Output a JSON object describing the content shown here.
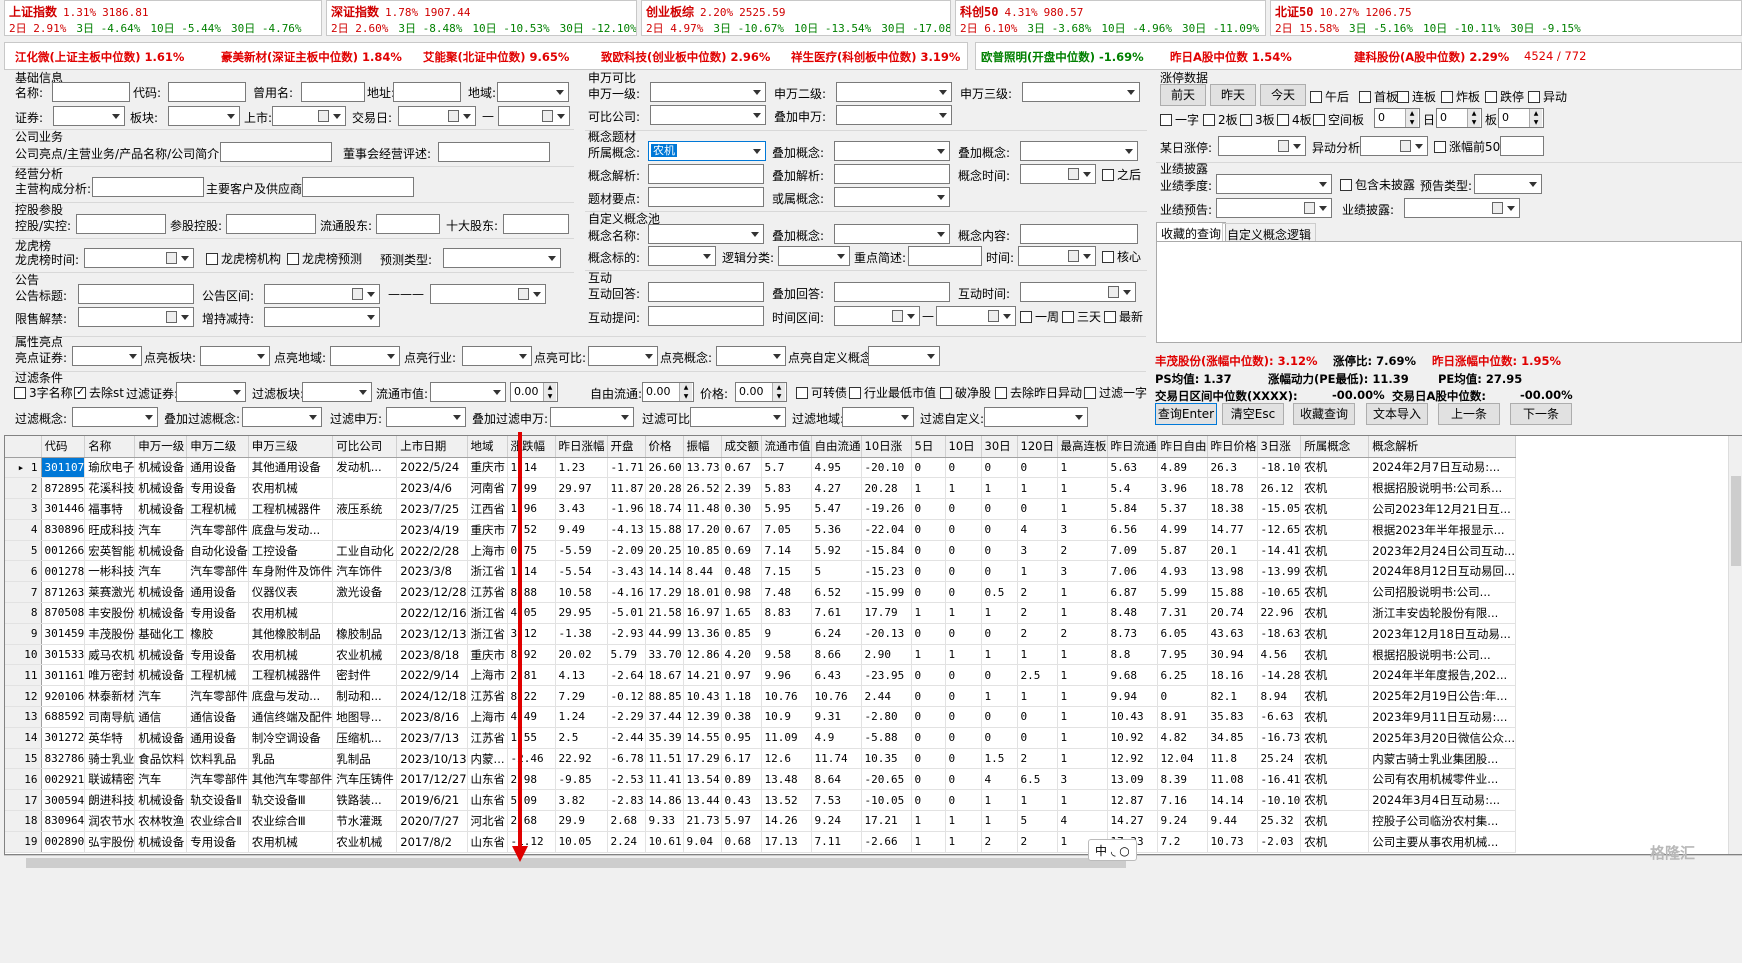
{
  "indices": [
    {
      "name": "上证指数",
      "pct": "1.31%",
      "value": "3186.81",
      "d2": "2日 2.91%",
      "d3": "3日 -4.64%",
      "d10": "10日 -5.44%",
      "d30": "30日 -4.76%"
    },
    {
      "name": "深证指数",
      "pct": "1.78%",
      "value": "1907.44",
      "d2": "2日 2.60%",
      "d3": "3日 -8.48%",
      "d10": "10日 -10.53%",
      "d30": "30日 -12.10%"
    },
    {
      "name": "创业板综",
      "pct": "2.20%",
      "value": "2525.59",
      "d2": "2日 4.97%",
      "d3": "3日 -10.67%",
      "d10": "10日 -13.54%",
      "d30": "30日 -17.08%"
    },
    {
      "name": "科创50",
      "pct": "4.31%",
      "value": "980.57",
      "d2": "2日 6.10%",
      "d3": "3日 -3.68%",
      "d10": "10日 -4.96%",
      "d30": "30日 -11.09%"
    },
    {
      "name": "北证50",
      "pct": "10.27%",
      "value": "1206.75",
      "d2": "2日 15.58%",
      "d3": "3日 -5.16%",
      "d10": "10日 -10.11%",
      "d30": "30日 -9.15%"
    }
  ],
  "marquee1": [
    "江化微(上证主板中位数) 1.61%",
    "豪美新材(深证主板中位数) 1.84%",
    "艾能聚(北证中位数) 9.65%",
    "致欧科技(创业板中位数) 2.96%",
    "祥生医疗(科创板中位数) 3.19%"
  ],
  "marquee2": [
    "欧普照明(开盘中位数) -1.69%",
    "昨日A股中位数 1.54%",
    "建科股份(A股中位数) 2.29%",
    "4524 / 772"
  ],
  "labels": {
    "basic": "基础信息",
    "name": "名称:",
    "code": "代码:",
    "oldname": "曾用名:",
    "addr": "地址:",
    "region": "地域:",
    "sec": "证券:",
    "board": "板块:",
    "list": "上市:",
    "tday": "交易日:",
    "dash": "—",
    "biz": "公司业务",
    "bizhl": "公司亮点/主营业务/产品名称/公司简介:",
    "boardrev": "董事会经营评述:",
    "ops": "经营分析",
    "mainbiz": "主营构成分析:",
    "cust": "主要客户及供应商:",
    "hold": "控股参股",
    "holdctrl": "控股/实控:",
    "part": "参股控股:",
    "float": "流通股东:",
    "top10": "十大股东:",
    "lhb": "龙虎榜",
    "lhbtime": "龙虎榜时间:",
    "lhbinst": "龙虎榜机构",
    "lhbpred": "龙虎榜预测",
    "predtype": "预测类型:",
    "ann": "公告",
    "anntitle": "公告标题:",
    "annrange": "公告区间:",
    "annline": "———",
    "unlock": "限售解禁:",
    "incdec": "增持减持:",
    "sw": "申万可比",
    "sw1": "申万一级:",
    "sw2": "申万二级:",
    "sw3": "申万三级:",
    "comp": "可比公司:",
    "addsw": "叠加申万:",
    "concept": "概念题材",
    "ownconcept": "所属概念:",
    "ownconceptval": "农机",
    "addconcept": "叠加概念:",
    "addconcept2": "叠加概念:",
    "cparse": "概念解析:",
    "addparse": "叠加解析:",
    "ctime": "概念时间:",
    "after": "之后",
    "keypoint": "题材要点:",
    "orconcept": "或属概念:",
    "custom": "自定义概念池",
    "cname": "概念名称:",
    "addc": "叠加概念:",
    "ccontent": "概念内容:",
    "ctarget": "概念标的:",
    "logic": "逻辑分类:",
    "keydesc": "重点简述:",
    "time": "时间:",
    "core": "核心",
    "interact": "互动",
    "iq": "互动回答:",
    "addq": "叠加回答:",
    "itime": "互动时间:",
    "ia": "互动提问:",
    "trange": "时间区间:",
    "tdash": "—",
    "week": "一周",
    "three": "三天",
    "latest": "最新",
    "highlight": "属性亮点",
    "hlsec": "亮点证券:",
    "hlboard": "点亮板块:",
    "hlregion": "点亮地域:",
    "hlind": "点亮行业:",
    "hlcomp": "点亮可比:",
    "hlconcept": "点亮概念:",
    "hlcustom": "点亮自定义概念:",
    "filter": "过滤条件",
    "f3": "3字名称",
    "fst": "去除st",
    "fsec": "过滤证券:",
    "fboard": "过滤板块:",
    "fmv": "流通市值:",
    "fmvval": "0.00",
    "ffree": "自由流通:",
    "ffreeval": "0.00",
    "fprice": "价格:",
    "fpriceval": "0.00",
    "fcb": "可转债",
    "flow": "行业最低市值",
    "fbreak": "破净股",
    "fabn": "去除昨日异动",
    "fone": "过滤一字",
    "fconcept": "过滤概念:",
    "faddconcept": "叠加过滤概念:",
    "fsw": "过滤申万:",
    "faddsw": "叠加过滤申万:",
    "fcomp": "过滤可比:",
    "fregion": "过滤地域:",
    "fcustom": "过滤自定义:",
    "limit": "涨停数据",
    "prev": "前天",
    "yest": "昨天",
    "today": "今天",
    "noon": "午后",
    "first": "首板",
    "cont": "连板",
    "blow": "炸板",
    "down": "跌停",
    "abn": "异动",
    "one": "一字",
    "b2": "2板",
    "b3": "3板",
    "b4": "4板",
    "empty": "空间板",
    "sp1": "0",
    "day": "日",
    "sp2": "0",
    "ban": "板",
    "sp3": "0",
    "someday": "某日涨停:",
    "abnanal": "异动分析:",
    "top50": "涨幅前50",
    "perf": "业绩披露",
    "perfq": "业绩季度:",
    "incl": "包含未披露",
    "pretype": "预告类型:",
    "perfpre": "业绩预告:",
    "perfdisc": "业绩披露:",
    "tabfav": "收藏的查询",
    "tabcustom": "自定义概念逻辑",
    "stat1": "丰茂股份(涨幅中位数): 3.12%",
    "stat2": "涨停比: 7.69%",
    "stat3": "昨日涨幅中位数: 1.95%",
    "pe": "PS均值: 1.37",
    "power": "涨幅动力(PE最低): 11.39",
    "pemean": "PE均值: 27.95",
    "mid1": "交易日区间中位数(XXXX):",
    "mid1v": "-00.00%",
    "mid2": "交易日A股中位数:",
    "mid2v": "-00.00%",
    "bquery": "查询Enter",
    "bclear": "清空Esc",
    "bfav": "收藏查询",
    "bimport": "文本导入",
    "bprev": "上一条",
    "bnext": "下一条",
    "ime": "中 ◟ ○",
    "watermark": "格隆汇"
  },
  "table": {
    "headers": [
      "代码",
      "名称",
      "申万一级",
      "申万二级",
      "申万三级",
      "可比公司",
      "上市日期",
      "地域",
      "涨跌幅",
      "昨日涨幅",
      "开盘",
      "价格",
      "振幅",
      "成交额",
      "流通市值",
      "自由流通",
      "10日涨",
      "5日",
      "10日",
      "30日",
      "120日",
      "最高连板",
      "昨日流通",
      "昨日自由",
      "昨日价格",
      "3日涨",
      "所属概念",
      "概念解析"
    ],
    "rows": [
      [
        "301107",
        "瑜欣电子",
        "机械设备",
        "通用设备",
        "其他通用设备",
        "发动机...",
        "2022/5/24",
        "重庆市",
        "1.14",
        "1.23",
        "-1.71",
        "26.60",
        "13.73",
        "0.67",
        "5.7",
        "4.95",
        "-20.10",
        "0",
        "0",
        "0",
        "0",
        "1",
        "5.63",
        "4.89",
        "26.3",
        "-18.10",
        "农机",
        "2024年2月7日互动易:..."
      ],
      [
        "872895",
        "花溪科技",
        "机械设备",
        "专用设备",
        "农用机械",
        "",
        "2023/4/6",
        "河南省",
        "7.99",
        "29.97",
        "11.87",
        "20.28",
        "26.52",
        "2.39",
        "5.83",
        "4.27",
        "20.28",
        "1",
        "1",
        "1",
        "1",
        "1",
        "5.4",
        "3.96",
        "18.78",
        "26.12",
        "农机",
        "根据招股说明书:公司系..."
      ],
      [
        "301446",
        "福事特",
        "机械设备",
        "工程机械",
        "工程机械器件",
        "液压系统",
        "2023/7/25",
        "江西省",
        "1.96",
        "3.43",
        "-1.96",
        "18.74",
        "11.48",
        "0.30",
        "5.95",
        "5.47",
        "-19.26",
        "0",
        "0",
        "0",
        "0",
        "1",
        "5.84",
        "5.37",
        "18.38",
        "-15.05",
        "农机",
        "公司2023年12月21日互..."
      ],
      [
        "830896",
        "旺成科技",
        "汽车",
        "汽车零部件",
        "底盘与发动...",
        "",
        "2023/4/19",
        "重庆市",
        "7.52",
        "9.49",
        "-4.13",
        "15.88",
        "17.20",
        "0.67",
        "7.05",
        "5.36",
        "-22.04",
        "0",
        "0",
        "0",
        "4",
        "3",
        "6.56",
        "4.99",
        "14.77",
        "-12.65",
        "农机",
        "根据2023年半年报显示..."
      ],
      [
        "001266",
        "宏英智能",
        "机械设备",
        "自动化设备",
        "工控设备",
        "工业自动化",
        "2022/2/28",
        "上海市",
        "0.75",
        "-5.59",
        "-2.09",
        "20.25",
        "10.85",
        "0.69",
        "7.14",
        "5.92",
        "-15.84",
        "0",
        "0",
        "0",
        "3",
        "2",
        "7.09",
        "5.87",
        "20.1",
        "-14.41",
        "农机",
        "2023年2月24日公司互动..."
      ],
      [
        "001278",
        "一彬科技",
        "汽车",
        "汽车零部件",
        "车身附件及饰件",
        "汽车饰件",
        "2023/3/8",
        "浙江省",
        "1.14",
        "-5.54",
        "-3.43",
        "14.14",
        "8.44",
        "0.48",
        "7.15",
        "5",
        "-15.23",
        "0",
        "0",
        "0",
        "1",
        "3",
        "7.06",
        "4.93",
        "13.98",
        "-13.99",
        "农机",
        "2024年8月12日互动易回..."
      ],
      [
        "871263",
        "莱赛激光",
        "机械设备",
        "通用设备",
        "仪器仪表",
        "激光设备",
        "2023/12/28",
        "江苏省",
        "8.88",
        "10.58",
        "-4.16",
        "17.29",
        "18.01",
        "0.98",
        "7.48",
        "6.52",
        "-15.99",
        "0",
        "0",
        "0.5",
        "2",
        "1",
        "6.87",
        "5.99",
        "15.88",
        "-10.65",
        "农机",
        "公司招股说明书:公司..."
      ],
      [
        "870508",
        "丰安股份",
        "机械设备",
        "专用设备",
        "农用机械",
        "",
        "2022/12/16",
        "浙江省",
        "4.05",
        "29.95",
        "-5.01",
        "21.58",
        "16.97",
        "1.65",
        "8.83",
        "7.61",
        "17.79",
        "1",
        "1",
        "1",
        "2",
        "1",
        "8.48",
        "7.31",
        "20.74",
        "22.96",
        "农机",
        "浙江丰安齿轮股份有限..."
      ],
      [
        "301459",
        "丰茂股份",
        "基础化工",
        "橡胶",
        "其他橡胶制品",
        "橡胶制品",
        "2023/12/13",
        "浙江省",
        "3.12",
        "-1.38",
        "-2.93",
        "44.99",
        "13.36",
        "0.85",
        "9",
        "6.24",
        "-20.13",
        "0",
        "0",
        "0",
        "2",
        "2",
        "8.73",
        "6.05",
        "43.63",
        "-18.63",
        "农机",
        "2023年12月18日互动易..."
      ],
      [
        "301533",
        "威马农机",
        "机械设备",
        "专用设备",
        "农用机械",
        "农业机械",
        "2023/8/18",
        "重庆市",
        "8.92",
        "20.02",
        "5.79",
        "33.70",
        "12.86",
        "4.20",
        "9.58",
        "8.66",
        "2.90",
        "1",
        "1",
        "1",
        "1",
        "1",
        "8.8",
        "7.95",
        "30.94",
        "4.56",
        "农机",
        "根据招股说明书:公司..."
      ],
      [
        "301161",
        "唯万密封",
        "机械设备",
        "工程机械",
        "工程机械器件",
        "密封件",
        "2022/9/14",
        "上海市",
        "2.81",
        "4.13",
        "-2.64",
        "18.67",
        "14.21",
        "0.97",
        "9.96",
        "6.43",
        "-23.95",
        "0",
        "0",
        "0",
        "2.5",
        "1",
        "9.68",
        "6.25",
        "18.16",
        "-14.28",
        "农机",
        "2024年半年度报告,202..."
      ],
      [
        "920106",
        "林泰新材",
        "汽车",
        "汽车零部件",
        "底盘与发动...",
        "制动和...",
        "2024/12/18",
        "江苏省",
        "8.22",
        "7.29",
        "-0.12",
        "88.85",
        "10.43",
        "1.18",
        "10.76",
        "10.76",
        "2.44",
        "0",
        "0",
        "1",
        "1",
        "1",
        "9.94",
        "0",
        "82.1",
        "8.94",
        "农机",
        "2025年2月19日公告:年..."
      ],
      [
        "688592",
        "司南导航",
        "通信",
        "通信设备",
        "通信终端及配件",
        "地图导...",
        "2023/8/16",
        "上海市",
        "4.49",
        "1.24",
        "-2.29",
        "37.44",
        "12.39",
        "0.38",
        "10.9",
        "9.31",
        "-2.80",
        "0",
        "0",
        "0",
        "0",
        "1",
        "10.43",
        "8.91",
        "35.83",
        "-6.63",
        "农机",
        "2023年9月11日互动易:..."
      ],
      [
        "301272",
        "英华特",
        "机械设备",
        "通用设备",
        "制冷空调设备",
        "压缩机...",
        "2023/7/13",
        "江苏省",
        "1.55",
        "2.5",
        "-2.44",
        "35.39",
        "14.55",
        "0.95",
        "11.09",
        "4.9",
        "-5.88",
        "0",
        "0",
        "0",
        "0",
        "1",
        "10.92",
        "4.82",
        "34.85",
        "-16.73",
        "农机",
        "2025年3月20日微信公众..."
      ],
      [
        "832786",
        "骑士乳业",
        "食品饮料",
        "饮料乳品",
        "乳品",
        "乳制品",
        "2023/10/13",
        "内蒙...",
        "-2.46",
        "22.92",
        "-6.78",
        "11.51",
        "17.29",
        "6.17",
        "12.6",
        "11.74",
        "10.35",
        "0",
        "0",
        "1.5",
        "2",
        "1",
        "12.92",
        "12.04",
        "11.8",
        "25.24",
        "农机",
        "内蒙古骑士乳业集团股..."
      ],
      [
        "002921",
        "联诚精密",
        "汽车",
        "汽车零部件",
        "其他汽车零部件",
        "汽车压铸件",
        "2017/12/27",
        "山东省",
        "2.98",
        "-9.85",
        "-2.53",
        "11.41",
        "13.54",
        "0.89",
        "13.48",
        "8.64",
        "-20.65",
        "0",
        "0",
        "4",
        "6.5",
        "3",
        "13.09",
        "8.39",
        "11.08",
        "-16.41",
        "农机",
        "公司有农用机械零件业..."
      ],
      [
        "300594",
        "朗进科技",
        "机械设备",
        "轨交设备Ⅱ",
        "轨交设备Ⅲ",
        "铁路装...",
        "2019/6/21",
        "山东省",
        "5.09",
        "3.82",
        "-2.83",
        "14.86",
        "13.44",
        "0.43",
        "13.52",
        "7.53",
        "-10.05",
        "0",
        "0",
        "1",
        "1",
        "1",
        "12.87",
        "7.16",
        "14.14",
        "-10.10",
        "农机",
        "2024年3月4日互动易:..."
      ],
      [
        "830964",
        "润农节水",
        "农林牧渔",
        "农业综合Ⅱ",
        "农业综合Ⅲ",
        "节水灌溉",
        "2020/7/27",
        "河北省",
        "2.68",
        "29.9",
        "2.68",
        "9.33",
        "21.73",
        "5.97",
        "14.26",
        "9.24",
        "17.21",
        "1",
        "1",
        "1",
        "5",
        "4",
        "14.27",
        "9.24",
        "9.44",
        "25.32",
        "农机",
        "控股子公司临汾农村集..."
      ],
      [
        "002890",
        "弘宇股份",
        "机械设备",
        "专用设备",
        "农用机械",
        "农业机械",
        "2017/8/2",
        "山东省",
        "-1.12",
        "10.05",
        "2.24",
        "10.61",
        "9.04",
        "0.68",
        "17.13",
        "7.11",
        "-2.66",
        "1",
        "1",
        "2",
        "2",
        "1",
        "17.33",
        "7.2",
        "10.73",
        "-2.03",
        "农机",
        "公司主要从事农用机械..."
      ]
    ]
  },
  "colors": {
    "up": "#e00000",
    "down": "#008000",
    "select": "#0078d7",
    "arrow": "#e00000"
  }
}
